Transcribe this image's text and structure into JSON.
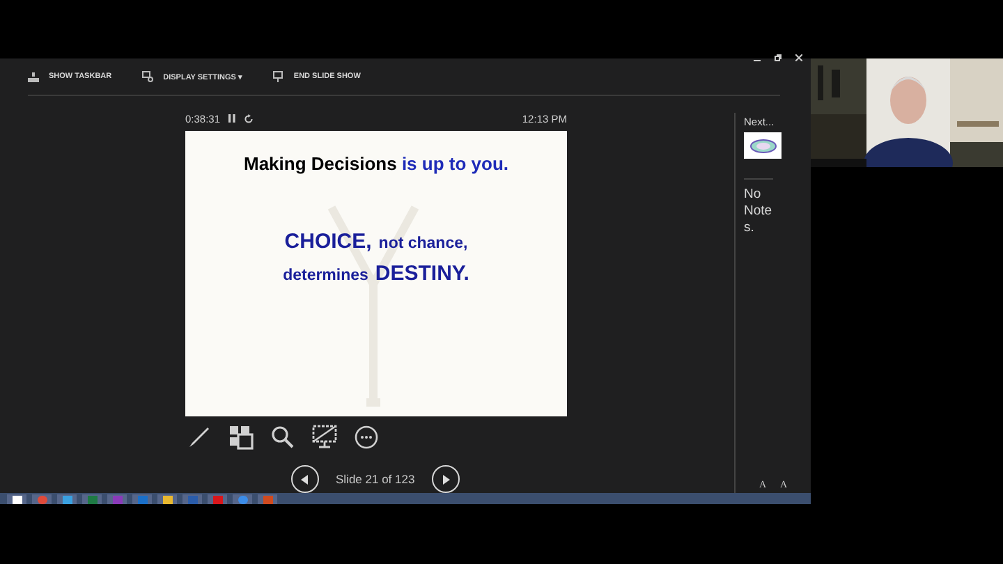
{
  "toolbar": [
    {
      "kind": "taskbar",
      "label": "SHOW TASKBAR"
    },
    {
      "kind": "display",
      "label": "DISPLAY SETTINGS ▾"
    },
    {
      "kind": "end",
      "label": "END SLIDE SHOW"
    }
  ],
  "timer": {
    "elapsed": "0:38:31",
    "clock": "12:13 PM"
  },
  "slide": {
    "title_lead": "Making Decisions",
    "title_emphasis": "is up to you.",
    "lines": [
      [
        {
          "text": "CHOICE,",
          "kind": "large"
        },
        {
          "text": "not chance,",
          "kind": "small"
        }
      ],
      [
        {
          "text": "determines",
          "kind": "small"
        },
        {
          "text": "DESTINY.",
          "kind": "large"
        }
      ]
    ]
  },
  "tools": [
    {
      "kind": "pen"
    },
    {
      "kind": "grid"
    },
    {
      "kind": "zoom"
    },
    {
      "kind": "screen"
    },
    {
      "kind": "more"
    }
  ],
  "navigation": {
    "label": "Slide 21 of 123"
  },
  "notes": {
    "next_label": "Next...",
    "text": "No Notes."
  },
  "font_size_buttons": [
    "A",
    "A"
  ],
  "taskbar": [
    {
      "kind": "start"
    },
    {
      "kind": "chrome"
    },
    {
      "kind": "edge"
    },
    {
      "kind": "excel"
    },
    {
      "kind": "onenote"
    },
    {
      "kind": "outlook"
    },
    {
      "kind": "folder"
    },
    {
      "kind": "word"
    },
    {
      "kind": "acrobat"
    },
    {
      "kind": "camera"
    },
    {
      "kind": "powerpoint"
    }
  ]
}
